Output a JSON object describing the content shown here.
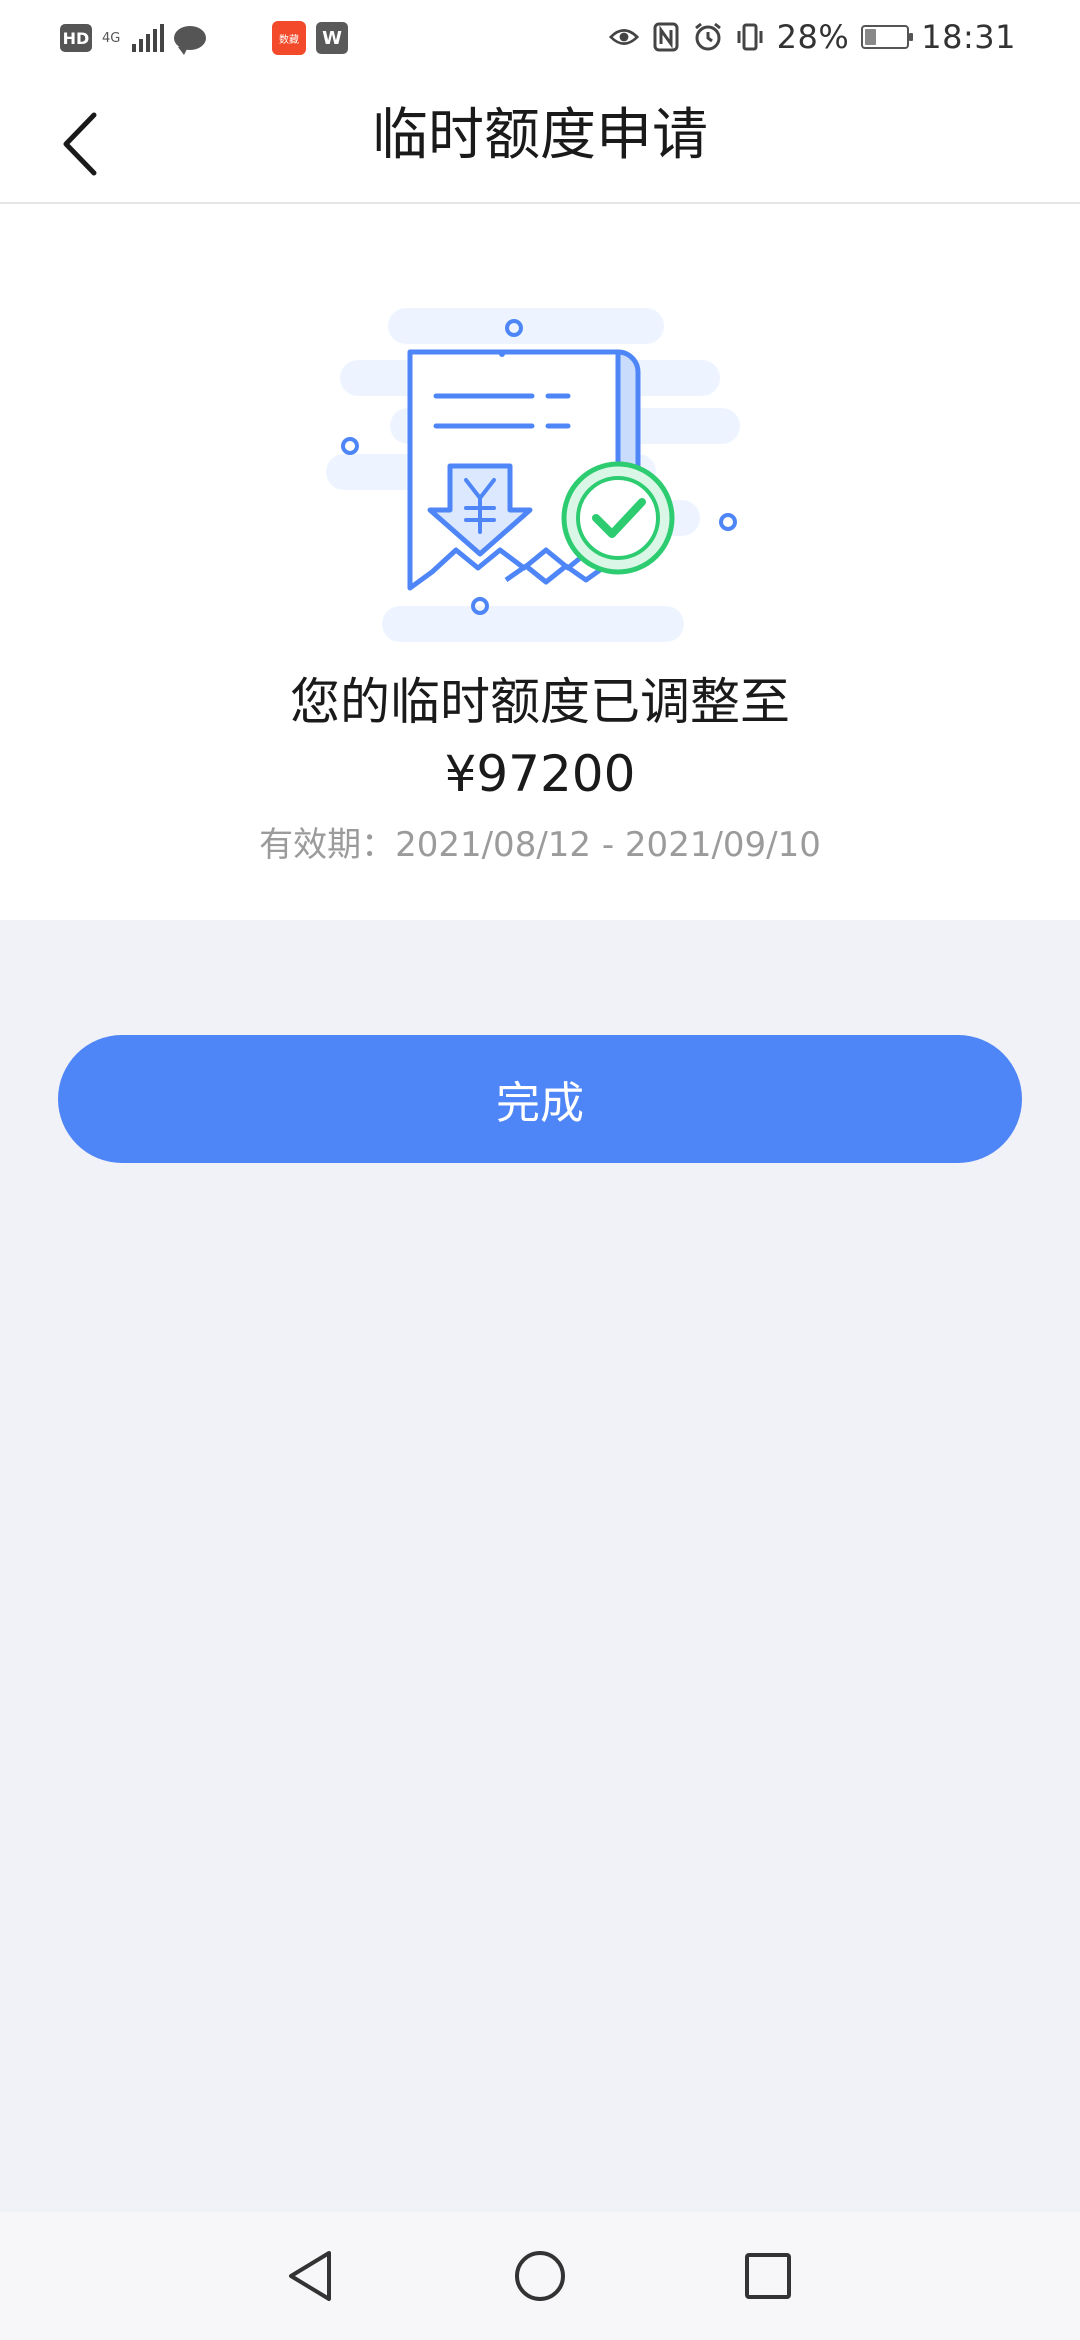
{
  "status_bar": {
    "hd_label": "HD",
    "network_label": "4G",
    "app_badge_1": "数藏",
    "app_badge_2": "W",
    "battery_percent": "28%",
    "battery_level": 0.28,
    "time": "18:31"
  },
  "header": {
    "title": "临时额度申请",
    "back_icon": "chevron-left-icon"
  },
  "result": {
    "title": "您的临时额度已调整至",
    "amount": "¥97200",
    "validity_label": "有效期：",
    "validity_range": "2021/08/12 - 2021/09/10",
    "illustration_icon": "receipt-success-icon"
  },
  "actions": {
    "done_label": "完成"
  },
  "colors": {
    "accent": "#4f86f7",
    "success": "#2ecc71",
    "background": "#f0f2f8"
  },
  "nav": {
    "back_icon": "nav-back-icon",
    "home_icon": "nav-home-icon",
    "recents_icon": "nav-recents-icon"
  }
}
